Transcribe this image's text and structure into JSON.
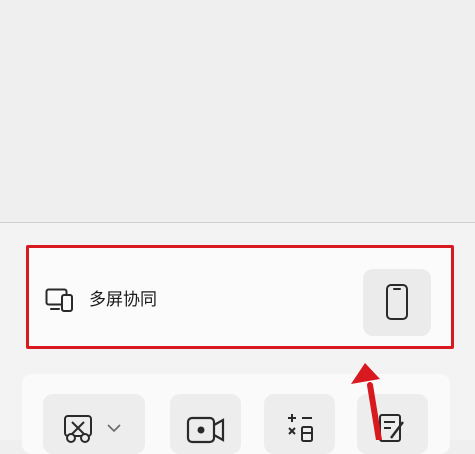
{
  "multiscreen": {
    "label": "多屏协同",
    "icon": "devices-icon",
    "action_icon": "phone-icon"
  },
  "quick_tiles": [
    {
      "icon": "cast-icon",
      "has_dropdown": true
    },
    {
      "icon": "video-camera-icon"
    },
    {
      "icon": "calculator-icon"
    },
    {
      "icon": "notes-edit-icon"
    }
  ],
  "annotation": {
    "highlight_color": "#d8191f",
    "arrow_color": "#d8191f"
  }
}
